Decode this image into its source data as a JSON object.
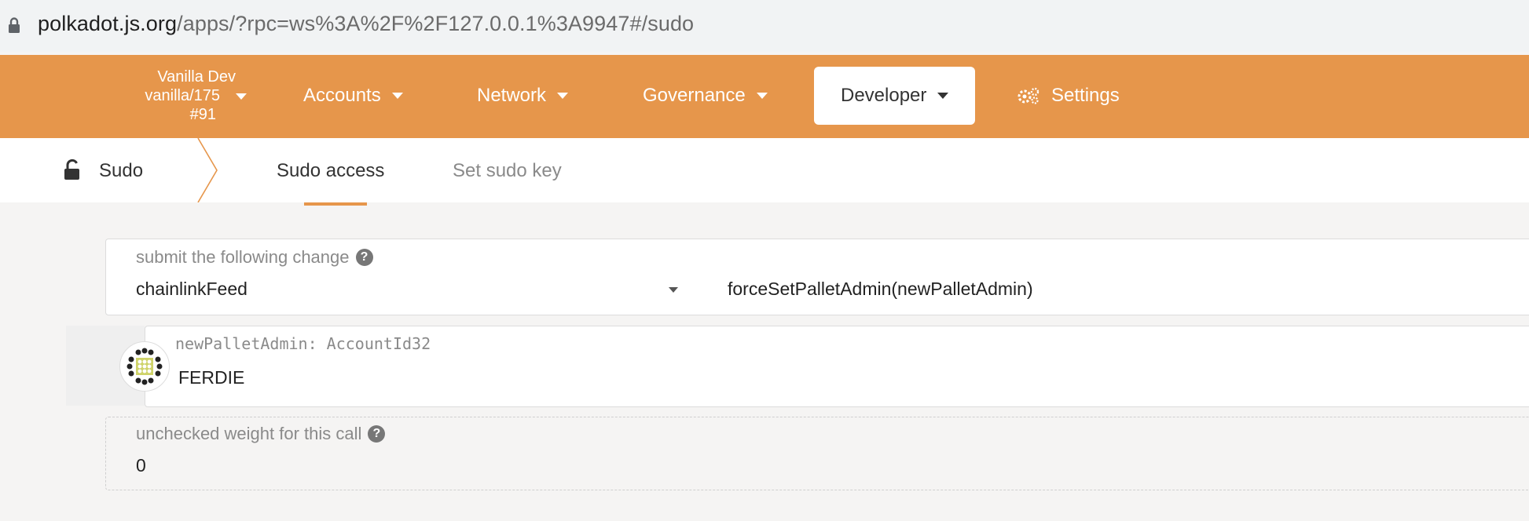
{
  "browser": {
    "url_host": "polkadot.js.org",
    "url_path": "/apps/?rpc=ws%3A%2F%2F127.0.0.1%3A9947#/sudo"
  },
  "chain": {
    "name": "Vanilla Dev",
    "version": "vanilla/175",
    "block": "#91"
  },
  "nav": {
    "accounts": "Accounts",
    "network": "Network",
    "governance": "Governance",
    "developer": "Developer",
    "settings": "Settings"
  },
  "tabs": {
    "section": "Sudo",
    "items": [
      "Sudo access",
      "Set sudo key"
    ],
    "active": "Sudo access"
  },
  "extrinsic": {
    "label": "submit the following change",
    "pallet": "chainlinkFeed",
    "method": "forceSetPalletAdmin(newPalletAdmin)"
  },
  "param": {
    "label": "newPalletAdmin: AccountId32",
    "value": "FERDIE"
  },
  "weight": {
    "label": "unchecked weight for this call",
    "value": "0"
  },
  "colors": {
    "accent": "#e6964b",
    "background": "#f5f4f3"
  }
}
